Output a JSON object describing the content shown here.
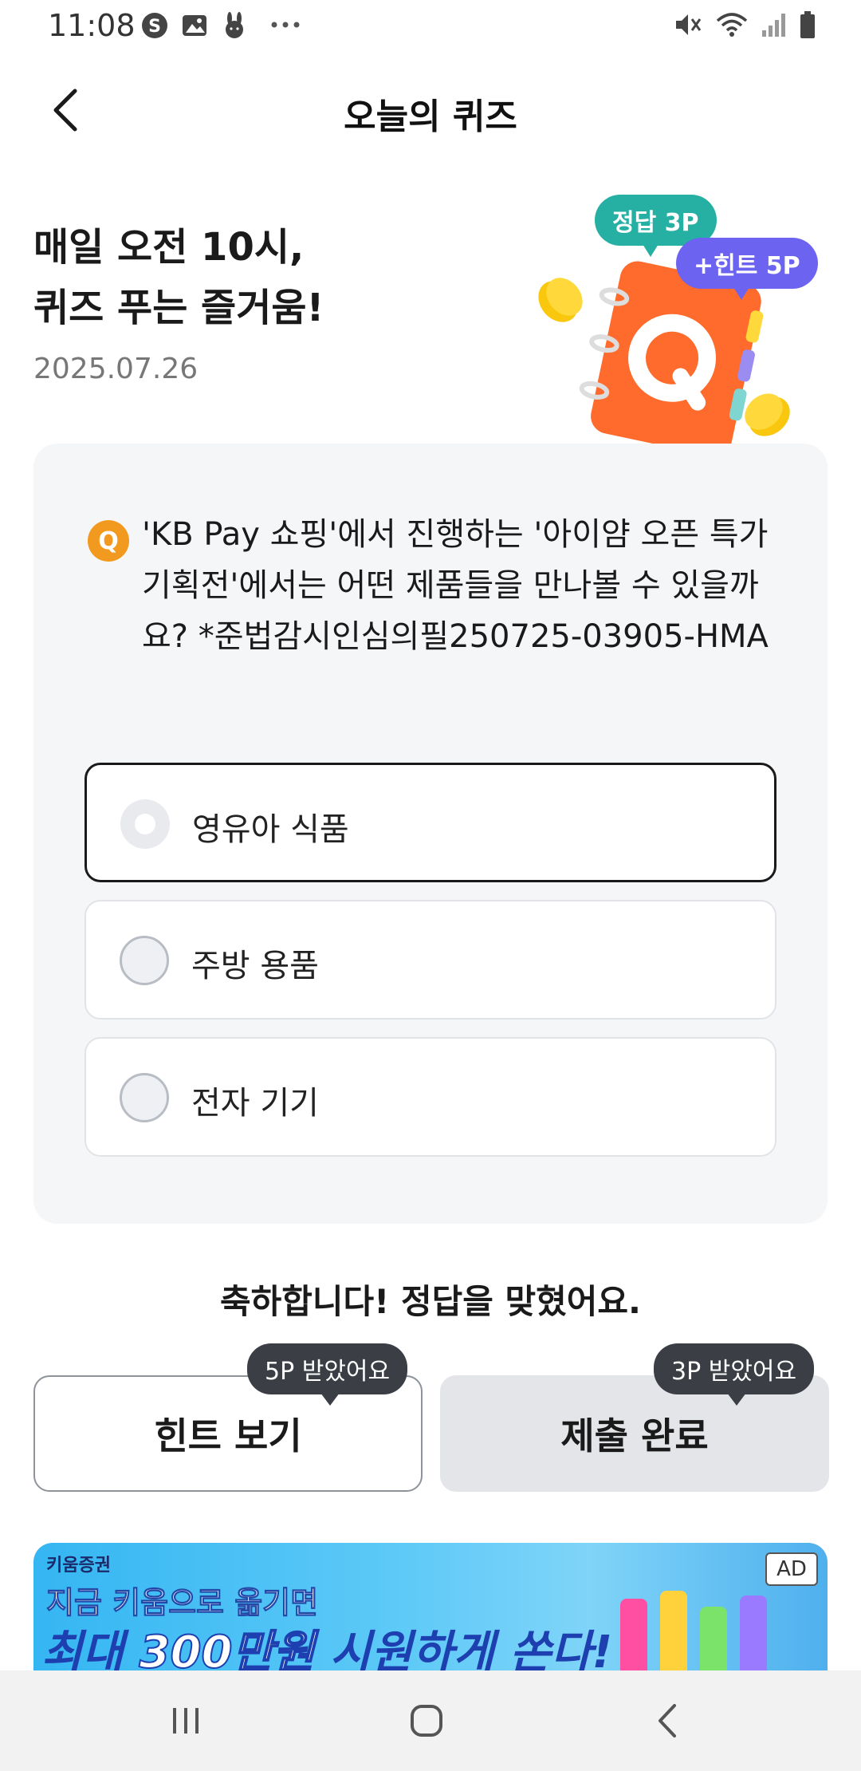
{
  "status_bar": {
    "time": "11:08",
    "left_icons": [
      "s-circle-icon",
      "image-icon",
      "rabbit-icon",
      "more-icon"
    ],
    "right_icons": [
      "mute-icon",
      "wifi-icon",
      "signal-icon",
      "battery-icon"
    ]
  },
  "header": {
    "title": "오늘의 퀴즈",
    "back_icon": "chevron-left-icon"
  },
  "hero": {
    "title": "매일 오전 10시,\n퀴즈 푸는 즐거움!",
    "date": "2025.07.26",
    "badge_answer": "정답 3P",
    "badge_hint": "+힌트 5P",
    "colors": {
      "answer_badge": "#25b0a3",
      "hint_badge": "#6c63f0",
      "notebook": "#ff6b2c"
    }
  },
  "quiz": {
    "q_badge": "Q",
    "question": "'KB Pay 쇼핑'에서 진행하는 '아이얌 오픈 특가 기획전'에서는 어떤 제품들을 만나볼 수 있을까요? *준법감시인심의필250725-03905-HMA",
    "options": [
      {
        "label": "영유아 식품",
        "selected": true
      },
      {
        "label": "주방 용품",
        "selected": false
      },
      {
        "label": "전자 기기",
        "selected": false
      }
    ]
  },
  "result": {
    "message": "축하합니다! 정답을 맞혔어요.",
    "hint_button": "힌트 보기",
    "hint_tooltip": "5P 받았어요",
    "submit_button": "제출 완료",
    "submit_tooltip": "3P 받았어요"
  },
  "ad": {
    "brand": "키움증권",
    "headline1": "지금 키움으로 옮기면",
    "headline2_prefix": "최대 ",
    "headline2_highlight": "300만원",
    "headline2_suffix": " 시원하게 쏜다!",
    "tag": "AD"
  },
  "nav": {
    "recent_icon": "recent-apps-icon",
    "home_icon": "home-icon",
    "back_icon": "back-icon"
  }
}
